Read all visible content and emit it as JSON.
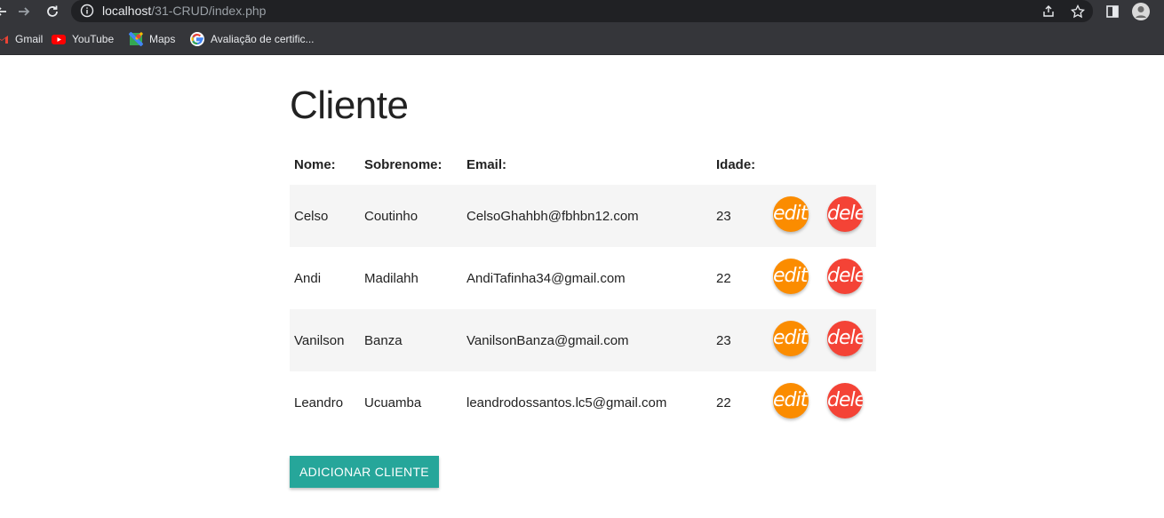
{
  "browser": {
    "url_host": "localhost",
    "url_path": "/31-CRUD/index.php",
    "bookmarks": [
      {
        "label": "Gmail",
        "icon": "gmail-icon"
      },
      {
        "label": "YouTube",
        "icon": "youtube-icon"
      },
      {
        "label": "Maps",
        "icon": "maps-icon"
      },
      {
        "label": "Avaliação de certific...",
        "icon": "google-icon"
      }
    ]
  },
  "page": {
    "title": "Cliente",
    "table": {
      "headers": [
        "Nome:",
        "Sobrenome:",
        "Email:",
        "Idade:"
      ],
      "rows": [
        {
          "nome": "Celso",
          "sobrenome": "Coutinho",
          "email": "CelsoGhahbh@fbhbn12.com",
          "idade": "23",
          "edit": "edit",
          "delete": "delete"
        },
        {
          "nome": "Andi",
          "sobrenome": "Madilahh",
          "email": "AndiTafinha34@gmail.com",
          "idade": "22",
          "edit": "edit",
          "delete": "delete"
        },
        {
          "nome": "Vanilson",
          "sobrenome": "Banza",
          "email": "VanilsonBanza@gmail.com",
          "idade": "23",
          "edit": "edit",
          "delete": "delete"
        },
        {
          "nome": "Leandro",
          "sobrenome": "Ucuamba",
          "email": "leandrodossantos.lc5@gmail.com",
          "idade": "22",
          "edit": "edit",
          "delete": "delete"
        }
      ]
    },
    "add_button": "ADICIONAR CLIENTE"
  },
  "colors": {
    "edit": "#fb8c00",
    "delete": "#f44336",
    "add_button": "#26a69a",
    "chrome": "#35363a"
  }
}
